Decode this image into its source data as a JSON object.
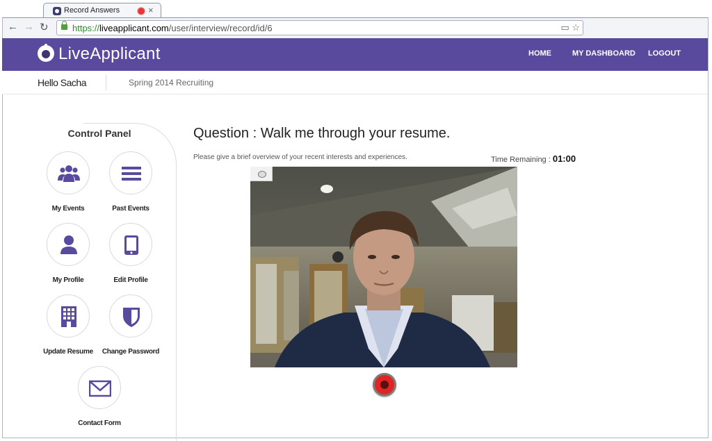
{
  "browser": {
    "tab_title": "Record Answers",
    "url_scheme": "https://",
    "url_host": "liveapplicant.com",
    "url_path": "/user/interview/record/id/6"
  },
  "site": {
    "brand": "LiveApplicant",
    "brand_color": "#5a4a9e",
    "nav": [
      "HOME",
      "MY DASHBOARD",
      "LOGOUT"
    ]
  },
  "subheader": {
    "greeting": "Hello Sacha",
    "context": "Spring 2014 Recruiting"
  },
  "control_panel": {
    "title": "Control Panel",
    "items": [
      {
        "label": "My Events",
        "icon": "group-icon"
      },
      {
        "label": "Past Events",
        "icon": "list-icon"
      },
      {
        "label": "My Profile",
        "icon": "user-icon"
      },
      {
        "label": "Edit Profile",
        "icon": "tablet-icon"
      },
      {
        "label": "Update Resume",
        "icon": "building-icon"
      },
      {
        "label": "Change Password",
        "icon": "shield-icon"
      },
      {
        "label": "Contact Form",
        "icon": "envelope-icon"
      }
    ],
    "icon_color": "#5a4a9e"
  },
  "interview": {
    "question_prefix": "Question : ",
    "question": "Walk me through your resume.",
    "description": "Please give a brief overview of your recent interests and experiences.",
    "time_label": "Time Remaining : ",
    "time_value": "01:00"
  },
  "recorder": {
    "record_color": "#e12424"
  }
}
